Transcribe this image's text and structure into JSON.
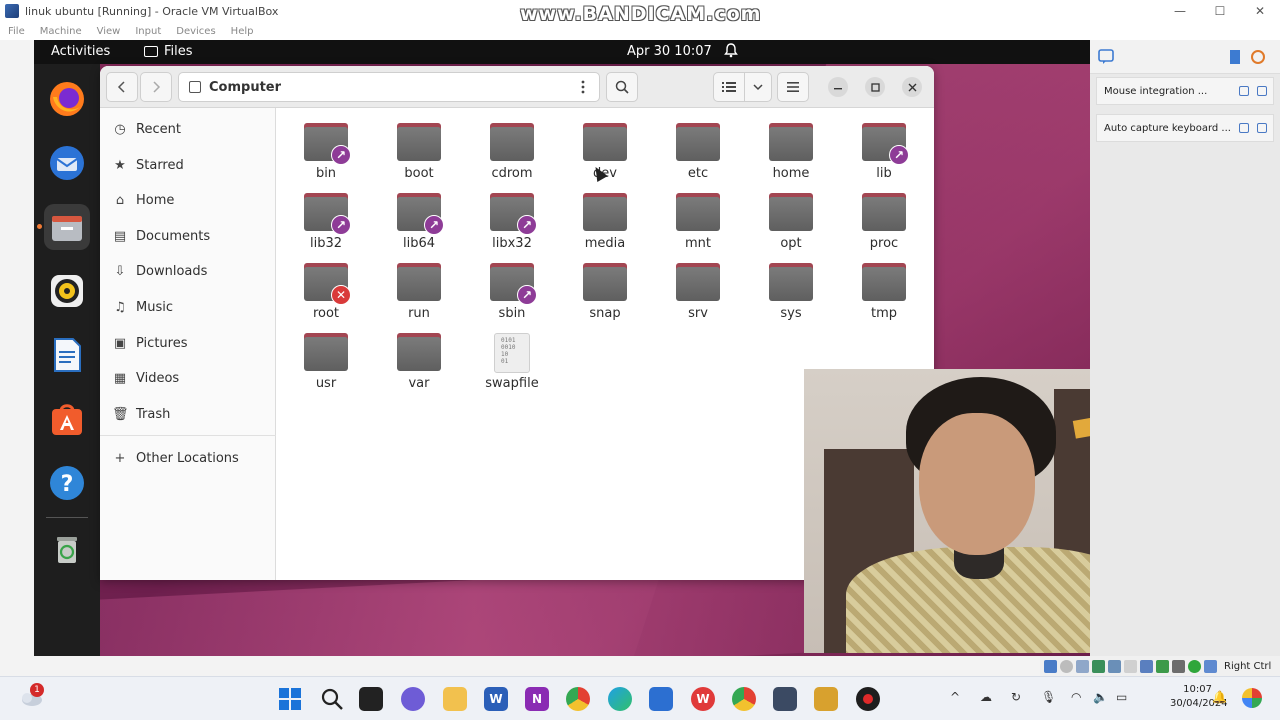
{
  "host_window": {
    "title": "linuk ubuntu [Running] - Oracle VM VirtualBox",
    "menu": [
      "File",
      "Machine",
      "View",
      "Input",
      "Devices",
      "Help"
    ],
    "minimize": "—",
    "maximize": "☐",
    "close": "✕"
  },
  "watermark": "www.BANDICAM.com",
  "gnome_topbar": {
    "activities": "Activities",
    "app_name": "Files",
    "clock": "Apr 30  10:07"
  },
  "dock": {
    "items": [
      "firefox-icon",
      "thunderbird-icon",
      "files-icon",
      "rhythmbox-icon",
      "writer-icon",
      "software-icon",
      "help-icon",
      "trash-icon"
    ],
    "active": "files-icon"
  },
  "files": {
    "location": "Computer",
    "sidebar": [
      {
        "label": "Recent",
        "icon": "clock-icon"
      },
      {
        "label": "Starred",
        "icon": "star-icon"
      },
      {
        "label": "Home",
        "icon": "home-icon"
      },
      {
        "label": "Documents",
        "icon": "document-icon"
      },
      {
        "label": "Downloads",
        "icon": "download-icon"
      },
      {
        "label": "Music",
        "icon": "music-icon"
      },
      {
        "label": "Pictures",
        "icon": "picture-icon"
      },
      {
        "label": "Videos",
        "icon": "video-icon"
      },
      {
        "label": "Trash",
        "icon": "trash-icon"
      }
    ],
    "other_locations": "Other Locations",
    "items": [
      {
        "name": "bin",
        "emblem": "link"
      },
      {
        "name": "boot",
        "emblem": ""
      },
      {
        "name": "cdrom",
        "emblem": ""
      },
      {
        "name": "dev",
        "emblem": ""
      },
      {
        "name": "etc",
        "emblem": ""
      },
      {
        "name": "home",
        "emblem": ""
      },
      {
        "name": "lib",
        "emblem": "link"
      },
      {
        "name": "lib32",
        "emblem": "link"
      },
      {
        "name": "lib64",
        "emblem": "link"
      },
      {
        "name": "libx32",
        "emblem": "link"
      },
      {
        "name": "media",
        "emblem": ""
      },
      {
        "name": "mnt",
        "emblem": ""
      },
      {
        "name": "opt",
        "emblem": ""
      },
      {
        "name": "proc",
        "emblem": ""
      },
      {
        "name": "root",
        "emblem": "locked"
      },
      {
        "name": "run",
        "emblem": ""
      },
      {
        "name": "sbin",
        "emblem": "link"
      },
      {
        "name": "snap",
        "emblem": ""
      },
      {
        "name": "srv",
        "emblem": ""
      },
      {
        "name": "sys",
        "emblem": ""
      },
      {
        "name": "tmp",
        "emblem": ""
      },
      {
        "name": "usr",
        "emblem": ""
      },
      {
        "name": "var",
        "emblem": ""
      },
      {
        "name": "swapfile",
        "emblem": "locked",
        "kind": "binary"
      }
    ],
    "binary_glyph": "0101\n0010\n10\n01"
  },
  "vb_panel": {
    "notifications": [
      "Mouse integration ...",
      "Auto capture keyboard ..."
    ],
    "status_right": "Right Ctrl"
  },
  "taskbar": {
    "notification_count": "1",
    "time": "10:07",
    "date": "30/04/2024"
  }
}
